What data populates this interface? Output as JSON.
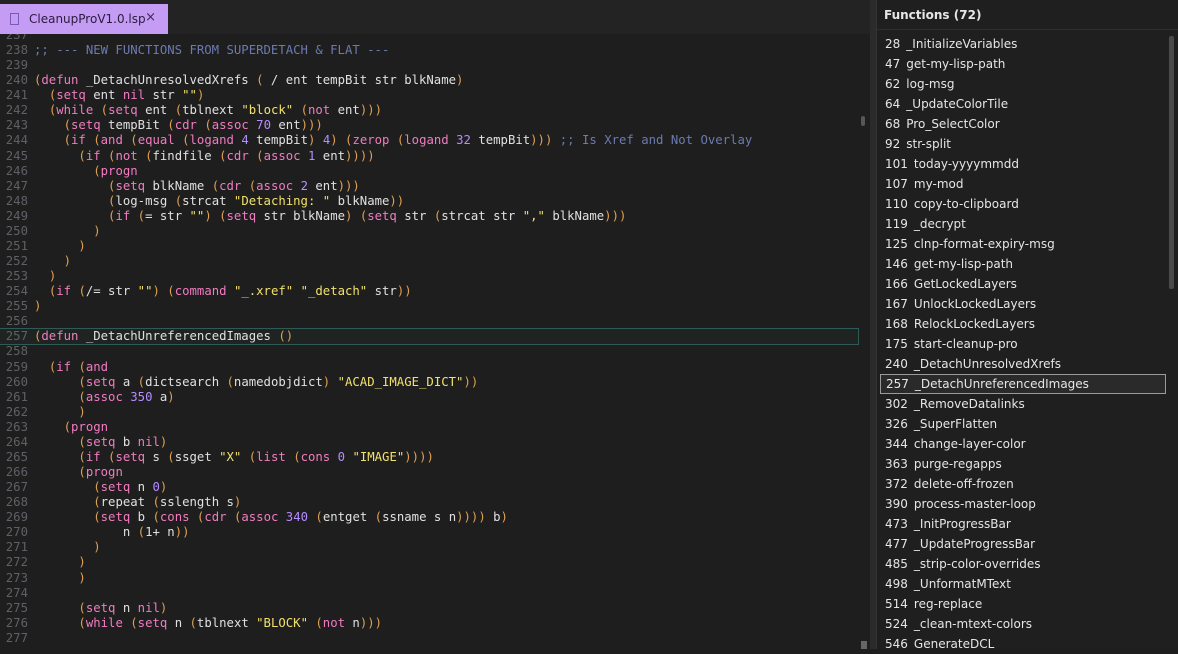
{
  "tab": {
    "filename": "CleanupProV1.0.lsp",
    "close": "×"
  },
  "editor": {
    "lines": [
      {
        "n": "237",
        "html": ""
      },
      {
        "n": "238",
        "html": "<span class=\"cmt\">;; --- NEW FUNCTIONS FROM SUPERDETACH &amp; FLAT ---</span>"
      },
      {
        "n": "239",
        "html": ""
      },
      {
        "n": "240",
        "html": "<span class=\"par\">(</span><span class=\"kw\">defun</span> _DetachUnresolvedXrefs <span class=\"par\">(</span> / ent tempBit str blkName<span class=\"par\">)</span>"
      },
      {
        "n": "241",
        "html": "  <span class=\"par\">(</span><span class=\"kw\">setq</span> ent <span class=\"kw\">nil</span> str <span class=\"str\">\"\"</span><span class=\"par\">)</span>"
      },
      {
        "n": "242",
        "html": "  <span class=\"par\">(</span><span class=\"kw\">while</span> <span class=\"par\">(</span><span class=\"kw\">setq</span> ent <span class=\"par\">(</span>tblnext <span class=\"str\">\"block\"</span> <span class=\"par\">(</span><span class=\"kw\">not</span> ent<span class=\"par\">)))</span>"
      },
      {
        "n": "243",
        "html": "    <span class=\"par\">(</span><span class=\"kw\">setq</span> tempBit <span class=\"par\">(</span><span class=\"kw\">cdr</span> <span class=\"par\">(</span><span class=\"kw\">assoc</span> <span class=\"num\">70</span> ent<span class=\"par\">)))</span>"
      },
      {
        "n": "244",
        "html": "    <span class=\"par\">(</span><span class=\"kw\">if</span> <span class=\"par\">(</span><span class=\"kw\">and</span> <span class=\"par\">(</span><span class=\"kw\">equal</span> <span class=\"par\">(</span><span class=\"kw\">logand</span> <span class=\"num\">4</span> tempBit<span class=\"par\">)</span> <span class=\"num\">4</span><span class=\"par\">)</span> <span class=\"par\">(</span><span class=\"kw\">zerop</span> <span class=\"par\">(</span><span class=\"kw\">logand</span> <span class=\"num\">32</span> tempBit<span class=\"par\">)))</span> <span class=\"cmt\">;; Is Xref and Not Overlay</span>"
      },
      {
        "n": "245",
        "html": "      <span class=\"par\">(</span><span class=\"kw\">if</span> <span class=\"par\">(</span><span class=\"kw\">not</span> <span class=\"par\">(</span>findfile <span class=\"par\">(</span><span class=\"kw\">cdr</span> <span class=\"par\">(</span><span class=\"kw\">assoc</span> <span class=\"num\">1</span> ent<span class=\"par\">))))</span>"
      },
      {
        "n": "246",
        "html": "        <span class=\"par\">(</span><span class=\"kw\">progn</span>"
      },
      {
        "n": "247",
        "html": "          <span class=\"par\">(</span><span class=\"kw\">setq</span> blkName <span class=\"par\">(</span><span class=\"kw\">cdr</span> <span class=\"par\">(</span><span class=\"kw\">assoc</span> <span class=\"num\">2</span> ent<span class=\"par\">)))</span>"
      },
      {
        "n": "248",
        "html": "          <span class=\"par\">(</span>log-msg <span class=\"par\">(</span>strcat <span class=\"str\">\"Detaching: \"</span> blkName<span class=\"par\">))</span>"
      },
      {
        "n": "249",
        "html": "          <span class=\"par\">(</span><span class=\"kw\">if</span> <span class=\"par\">(</span>= str <span class=\"str\">\"\"</span><span class=\"par\">)</span> <span class=\"par\">(</span><span class=\"kw\">setq</span> str blkName<span class=\"par\">)</span> <span class=\"par\">(</span><span class=\"kw\">setq</span> str <span class=\"par\">(</span>strcat str <span class=\"str\">\",\"</span> blkName<span class=\"par\">)))</span>"
      },
      {
        "n": "250",
        "html": "        <span class=\"par\">)</span>"
      },
      {
        "n": "251",
        "html": "      <span class=\"par\">)</span>"
      },
      {
        "n": "252",
        "html": "    <span class=\"par\">)</span>"
      },
      {
        "n": "253",
        "html": "  <span class=\"par\">)</span>"
      },
      {
        "n": "254",
        "html": "  <span class=\"par\">(</span><span class=\"kw\">if</span> <span class=\"par\">(</span>/= str <span class=\"str\">\"\"</span><span class=\"par\">)</span> <span class=\"par\">(</span><span class=\"kw\">command</span> <span class=\"str\">\"_.xref\"</span> <span class=\"str\">\"_detach\"</span> str<span class=\"par\">))</span>"
      },
      {
        "n": "255",
        "html": "<span class=\"par\">)</span>"
      },
      {
        "n": "256",
        "html": ""
      },
      {
        "n": "257",
        "html": "<span class=\"par\">(</span><span class=\"kw\">defun</span> _DetachUnreferencedImages <span class=\"par\">()</span>"
      },
      {
        "n": "258",
        "html": ""
      },
      {
        "n": "259",
        "html": "  <span class=\"par\">(</span><span class=\"kw\">if</span> <span class=\"par\">(</span><span class=\"kw\">and</span>"
      },
      {
        "n": "260",
        "html": "      <span class=\"par\">(</span><span class=\"kw\">setq</span> a <span class=\"par\">(</span>dictsearch <span class=\"par\">(</span>namedobjdict<span class=\"par\">)</span> <span class=\"str\">\"ACAD_IMAGE_DICT\"</span><span class=\"par\">))</span>"
      },
      {
        "n": "261",
        "html": "      <span class=\"par\">(</span><span class=\"kw\">assoc</span> <span class=\"num\">350</span> a<span class=\"par\">)</span>"
      },
      {
        "n": "262",
        "html": "      <span class=\"par\">)</span>"
      },
      {
        "n": "263",
        "html": "    <span class=\"par\">(</span><span class=\"kw\">progn</span>"
      },
      {
        "n": "264",
        "html": "      <span class=\"par\">(</span><span class=\"kw\">setq</span> b <span class=\"kw\">nil</span><span class=\"par\">)</span>"
      },
      {
        "n": "265",
        "html": "      <span class=\"par\">(</span><span class=\"kw\">if</span> <span class=\"par\">(</span><span class=\"kw\">setq</span> s <span class=\"par\">(</span>ssget <span class=\"str\">\"X\"</span> <span class=\"par\">(</span><span class=\"kw\">list</span> <span class=\"par\">(</span><span class=\"kw\">cons</span> <span class=\"num\">0</span> <span class=\"str\">\"IMAGE\"</span><span class=\"par\">))))</span>"
      },
      {
        "n": "266",
        "html": "      <span class=\"par\">(</span><span class=\"kw\">progn</span>"
      },
      {
        "n": "267",
        "html": "        <span class=\"par\">(</span><span class=\"kw\">setq</span> n <span class=\"num\">0</span><span class=\"par\">)</span>"
      },
      {
        "n": "268",
        "html": "        <span class=\"par\">(</span>repeat <span class=\"par\">(</span>sslength s<span class=\"par\">)</span>"
      },
      {
        "n": "269",
        "html": "        <span class=\"par\">(</span><span class=\"kw\">setq</span> b <span class=\"par\">(</span><span class=\"kw\">cons</span> <span class=\"par\">(</span><span class=\"kw\">cdr</span> <span class=\"par\">(</span><span class=\"kw\">assoc</span> <span class=\"num\">340</span> <span class=\"par\">(</span>entget <span class=\"par\">(</span>ssname s n<span class=\"par\">))))</span> b<span class=\"par\">)</span>"
      },
      {
        "n": "270",
        "html": "            n <span class=\"par\">(</span>1+ n<span class=\"par\">))</span>"
      },
      {
        "n": "271",
        "html": "        <span class=\"par\">)</span>"
      },
      {
        "n": "272",
        "html": "      <span class=\"par\">)</span>"
      },
      {
        "n": "273",
        "html": "      <span class=\"par\">)</span>"
      },
      {
        "n": "274",
        "html": ""
      },
      {
        "n": "275",
        "html": "      <span class=\"par\">(</span><span class=\"kw\">setq</span> n <span class=\"kw\">nil</span><span class=\"par\">)</span>"
      },
      {
        "n": "276",
        "html": "      <span class=\"par\">(</span><span class=\"kw\">while</span> <span class=\"par\">(</span><span class=\"kw\">setq</span> n <span class=\"par\">(</span>tblnext <span class=\"str\">\"BLOCK\"</span> <span class=\"par\">(</span><span class=\"kw\">not</span> n<span class=\"par\">)))</span>"
      },
      {
        "n": "277",
        "html": ""
      }
    ]
  },
  "functions": {
    "title": "Functions (72)",
    "items": [
      {
        "n": "28",
        "name": "_InitializeVariables"
      },
      {
        "n": "47",
        "name": "get-my-lisp-path"
      },
      {
        "n": "62",
        "name": "log-msg"
      },
      {
        "n": "64",
        "name": "_UpdateColorTile"
      },
      {
        "n": "68",
        "name": "Pro_SelectColor"
      },
      {
        "n": "92",
        "name": "str-split"
      },
      {
        "n": "101",
        "name": "today-yyyymmdd"
      },
      {
        "n": "107",
        "name": "my-mod"
      },
      {
        "n": "110",
        "name": "copy-to-clipboard"
      },
      {
        "n": "119",
        "name": "_decrypt"
      },
      {
        "n": "125",
        "name": "clnp-format-expiry-msg"
      },
      {
        "n": "146",
        "name": "get-my-lisp-path"
      },
      {
        "n": "166",
        "name": "GetLockedLayers"
      },
      {
        "n": "167",
        "name": "UnlockLockedLayers"
      },
      {
        "n": "168",
        "name": "RelockLockedLayers"
      },
      {
        "n": "175",
        "name": "start-cleanup-pro"
      },
      {
        "n": "240",
        "name": "_DetachUnresolvedXrefs"
      },
      {
        "n": "257",
        "name": "_DetachUnreferencedImages",
        "selected": true
      },
      {
        "n": "302",
        "name": "_RemoveDatalinks"
      },
      {
        "n": "326",
        "name": "_SuperFlatten"
      },
      {
        "n": "344",
        "name": "change-layer-color"
      },
      {
        "n": "363",
        "name": "purge-regapps"
      },
      {
        "n": "372",
        "name": "delete-off-frozen"
      },
      {
        "n": "390",
        "name": "process-master-loop"
      },
      {
        "n": "473",
        "name": "_InitProgressBar"
      },
      {
        "n": "477",
        "name": "_UpdateProgressBar"
      },
      {
        "n": "485",
        "name": "_strip-color-overrides"
      },
      {
        "n": "498",
        "name": "_UnformatMText"
      },
      {
        "n": "514",
        "name": "reg-replace"
      },
      {
        "n": "524",
        "name": "_clean-mtext-colors"
      },
      {
        "n": "546",
        "name": "GenerateDCL"
      }
    ]
  }
}
